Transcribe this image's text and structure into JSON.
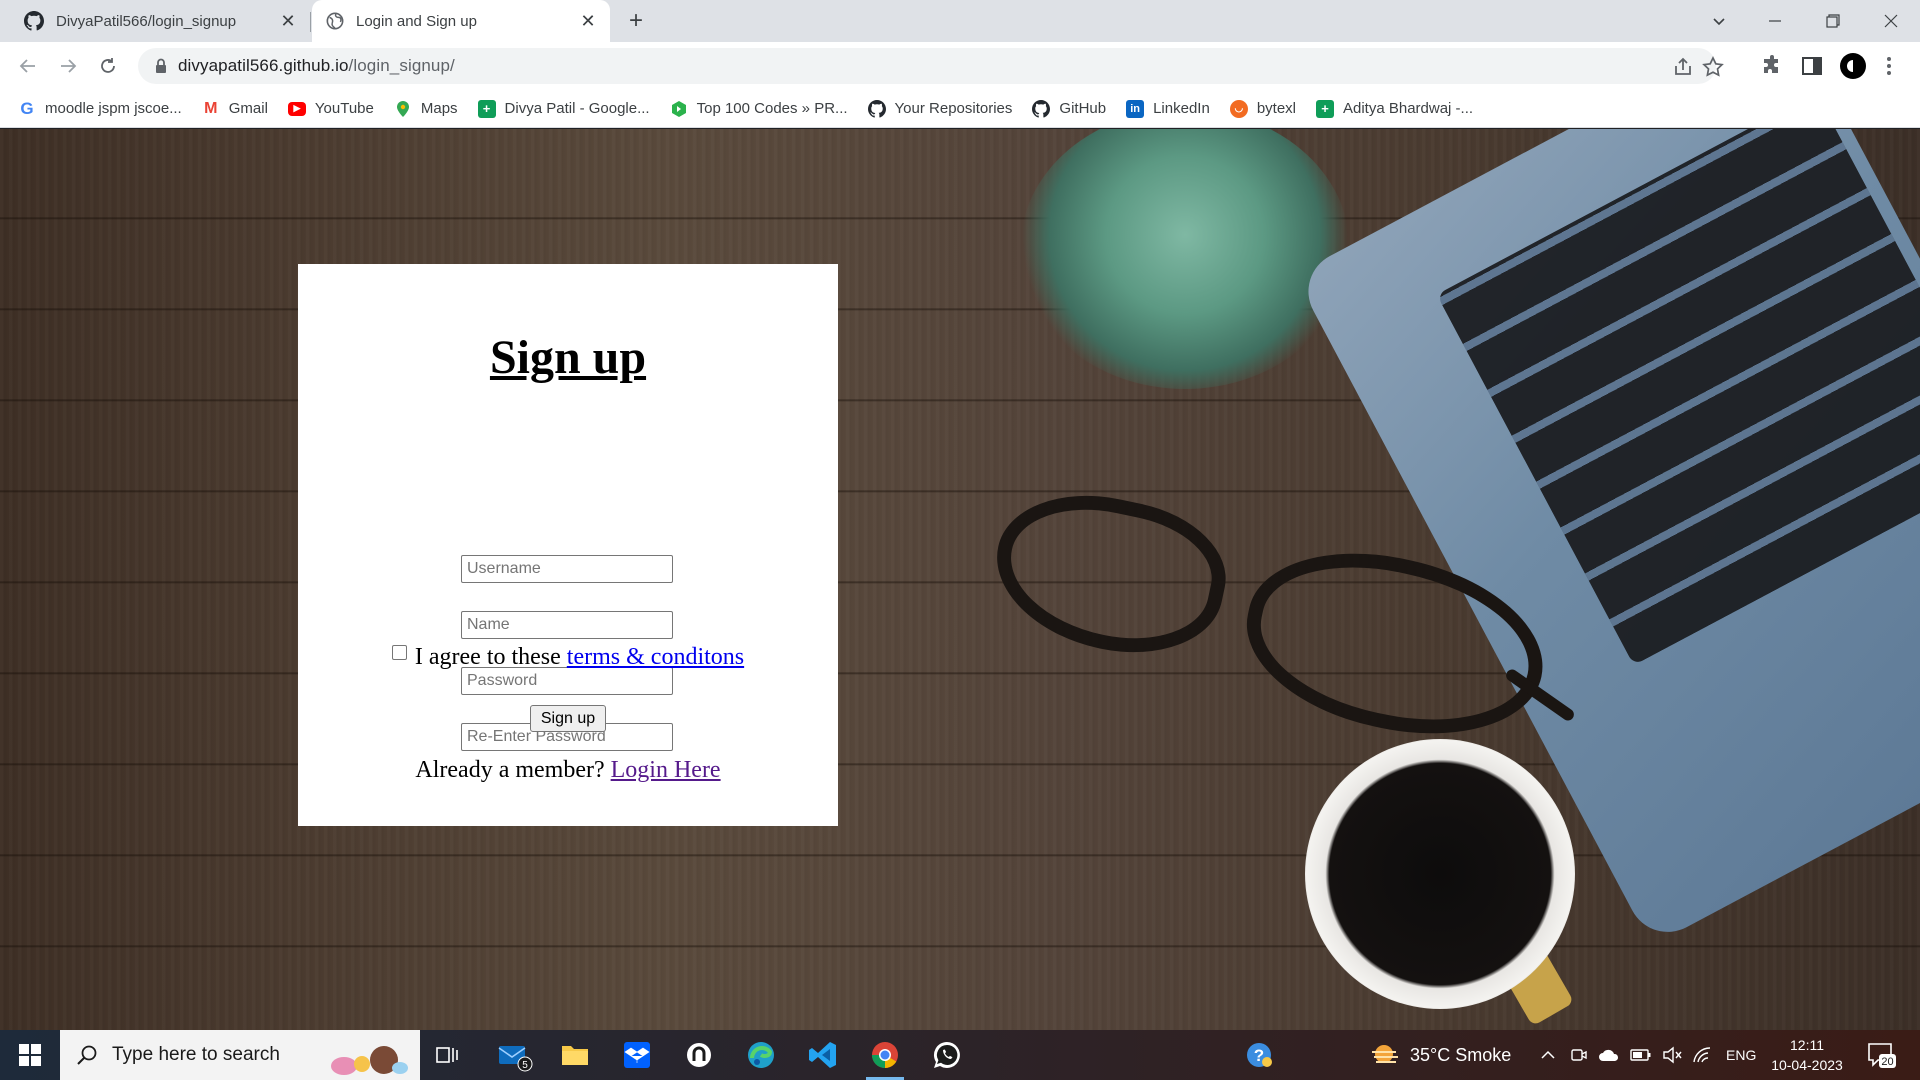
{
  "browser": {
    "tabs": [
      {
        "title": "DivyaPatil566/login_signup",
        "active": false
      },
      {
        "title": "Login and Sign up",
        "active": true
      }
    ],
    "url_host": "divyapatil566.github.io",
    "url_path": "/login_signup/",
    "bookmarks": [
      {
        "label": "moodle jspm jscoe...",
        "icon": "google-icon"
      },
      {
        "label": "Gmail",
        "icon": "gmail-icon"
      },
      {
        "label": "YouTube",
        "icon": "youtube-icon"
      },
      {
        "label": "Maps",
        "icon": "maps-icon"
      },
      {
        "label": "Divya Patil - Google...",
        "icon": "sheets-icon"
      },
      {
        "label": "Top 100 Codes » PR...",
        "icon": "codes-icon"
      },
      {
        "label": "Your Repositories",
        "icon": "github-icon"
      },
      {
        "label": "GitHub",
        "icon": "github-icon"
      },
      {
        "label": "LinkedIn",
        "icon": "linkedin-icon"
      },
      {
        "label": "bytexl",
        "icon": "bytexl-icon"
      },
      {
        "label": "Aditya Bhardwaj -...",
        "icon": "sheets-icon"
      }
    ]
  },
  "signup": {
    "heading": "Sign up",
    "username_placeholder": "Username",
    "name_placeholder": "Name",
    "password_placeholder": "Password",
    "reenter_placeholder": "Re-Enter Password",
    "agree_text": "I agree to these",
    "terms_link": "terms & conditons",
    "button_label": "Sign up",
    "member_text": "Already a member?",
    "login_link": "Login Here"
  },
  "taskbar": {
    "search_placeholder": "Type here to search",
    "mail_badge": "5",
    "weather": "35°C  Smoke",
    "language": "ENG",
    "time": "12:11",
    "date": "10-04-2023",
    "notification_count": "20"
  },
  "colors": {
    "link": "#0000ee",
    "visited_link": "#551a8b",
    "chrome_frame": "#dee1e6"
  }
}
